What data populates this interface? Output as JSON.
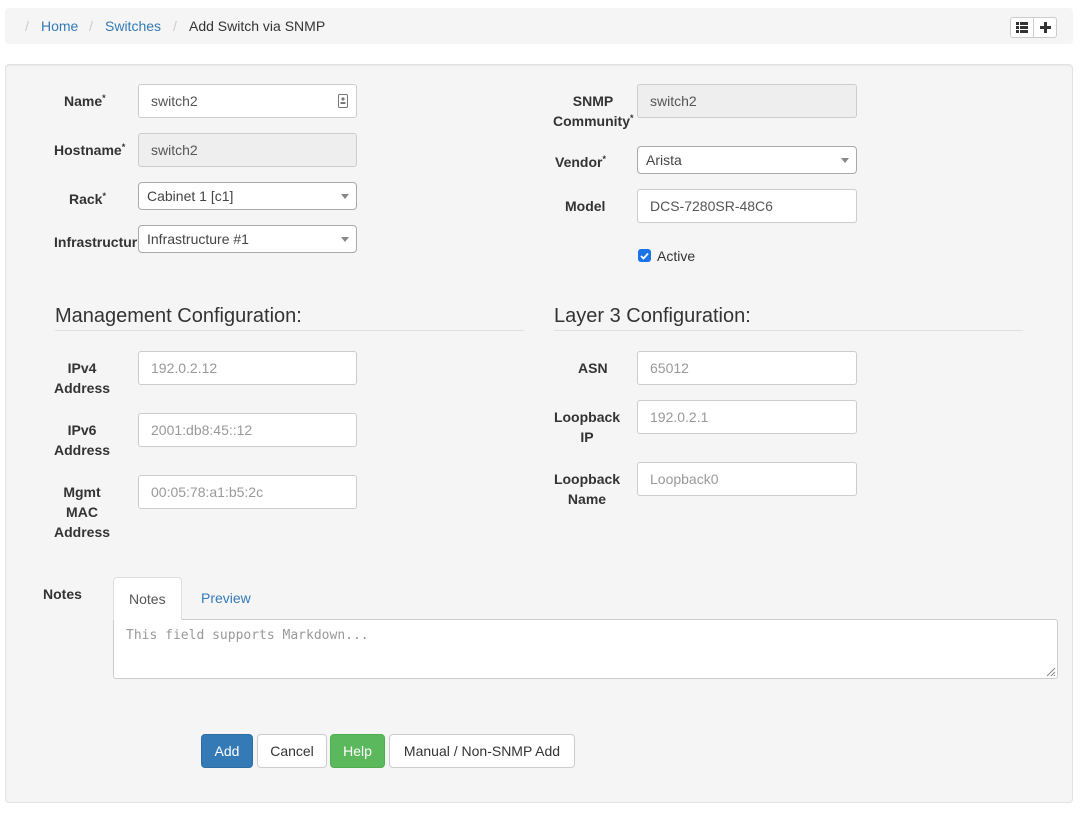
{
  "breadcrumb": {
    "items": [
      "Home",
      "Switches"
    ],
    "current": "Add Switch via SNMP"
  },
  "form": {
    "name": {
      "label": "Name",
      "value": "switch2"
    },
    "hostname": {
      "label": "Hostname",
      "value": "switch2"
    },
    "rack": {
      "label": "Rack",
      "value": "Cabinet 1 [c1]"
    },
    "infrastructure": {
      "label": "Infrastructur",
      "value": "Infrastructure #1"
    },
    "snmp_community": {
      "label_line1": "SNMP",
      "label_line2": "Community",
      "value": "switch2"
    },
    "vendor": {
      "label": "Vendor",
      "value": "Arista"
    },
    "model": {
      "label": "Model",
      "value": "DCS-7280SR-48C6"
    },
    "active": {
      "label": "Active",
      "checked": true
    }
  },
  "management": {
    "title": "Management Configuration:",
    "ipv4": {
      "label_line1": "IPv4",
      "label_line2": "Address",
      "placeholder": "192.0.2.12"
    },
    "ipv6": {
      "label_line1": "IPv6",
      "label_line2": "Address",
      "placeholder": "2001:db8:45::12"
    },
    "mac": {
      "label_line1": "Mgmt",
      "label_line2": "MAC",
      "label_line3": "Address",
      "placeholder": "00:05:78:a1:b5:2c"
    }
  },
  "layer3": {
    "title": "Layer 3 Configuration:",
    "asn": {
      "label": "ASN",
      "placeholder": "65012"
    },
    "loopback_ip": {
      "label_line1": "Loopback",
      "label_line2": "IP",
      "placeholder": "192.0.2.1"
    },
    "loopback_name": {
      "label_line1": "Loopback",
      "label_line2": "Name",
      "placeholder": "Loopback0"
    }
  },
  "notes": {
    "label": "Notes",
    "tabs": [
      "Notes",
      "Preview"
    ],
    "placeholder": "This field supports Markdown..."
  },
  "buttons": {
    "add": "Add",
    "cancel": "Cancel",
    "help": "Help",
    "manual": "Manual / Non-SNMP Add"
  },
  "icons": {
    "list_view": "list-icon",
    "add": "plus-icon",
    "autofill": "contact-card-icon",
    "dropdown": "chevron-down-icon",
    "resize": "resize-handle-icon"
  },
  "colors": {
    "primary": "#337ab7",
    "success": "#5cb85c",
    "checkbox": "#1a73e8"
  }
}
